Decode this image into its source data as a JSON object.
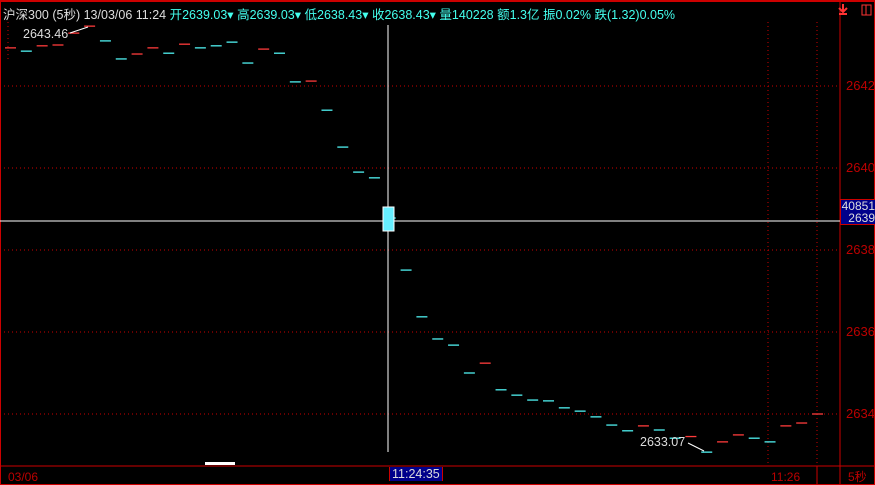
{
  "header": {
    "name": "沪深300",
    "period": "(5秒)",
    "date": "13/03/06",
    "time": "11:24",
    "open": "开2639.03▾",
    "high": "高2639.03▾",
    "low": "低2638.43▾",
    "close": "收2638.43▾",
    "volume": "量140228",
    "amount": "额1.3亿",
    "amplitude": "振0.02%",
    "change": "跌(1.32)0.05%"
  },
  "y_axis": {
    "ticks": [
      "2642",
      "2640",
      "2638",
      "2636",
      "2634"
    ],
    "tick_values": [
      2642,
      2640,
      2638,
      2636,
      2634
    ]
  },
  "cursor": {
    "volume": "40851",
    "price": "2639",
    "time": "11:24:35"
  },
  "x_axis": {
    "left": "03/06",
    "mid": "11:26",
    "period": "5秒"
  },
  "annotations": {
    "max": "2643.46",
    "min": "2633.07"
  },
  "colors": {
    "up": "#ff3b3b",
    "down": "#4ff0f0",
    "axis": "#cc0000"
  },
  "chart_data": {
    "type": "line",
    "values": [
      2642.93,
      2642.85,
      2642.98,
      2643.0,
      2643.29,
      2643.46,
      2643.1,
      2642.66,
      2642.78,
      2642.93,
      2642.8,
      2643.02,
      2642.93,
      2642.98,
      2643.07,
      2642.56,
      2642.9,
      2642.8,
      2642.1,
      2642.12,
      2641.41,
      2640.51,
      2639.9,
      2639.76,
      2638.78,
      2637.51,
      2636.37,
      2635.83,
      2635.68,
      2635.0,
      2635.24,
      2634.59,
      2634.46,
      2634.34,
      2634.32,
      2634.15,
      2634.07,
      2633.93,
      2633.73,
      2633.59,
      2633.71,
      2633.61,
      2633.41,
      2633.45,
      2633.07,
      2633.32,
      2633.49,
      2633.41,
      2633.32,
      2633.71,
      2633.78,
      2634.0
    ],
    "directions": "rcrrrrccrrcrcccc r c c r c c c c c c c c c c r c c c c c c c c c r c c r c r r c c r r r"
  }
}
